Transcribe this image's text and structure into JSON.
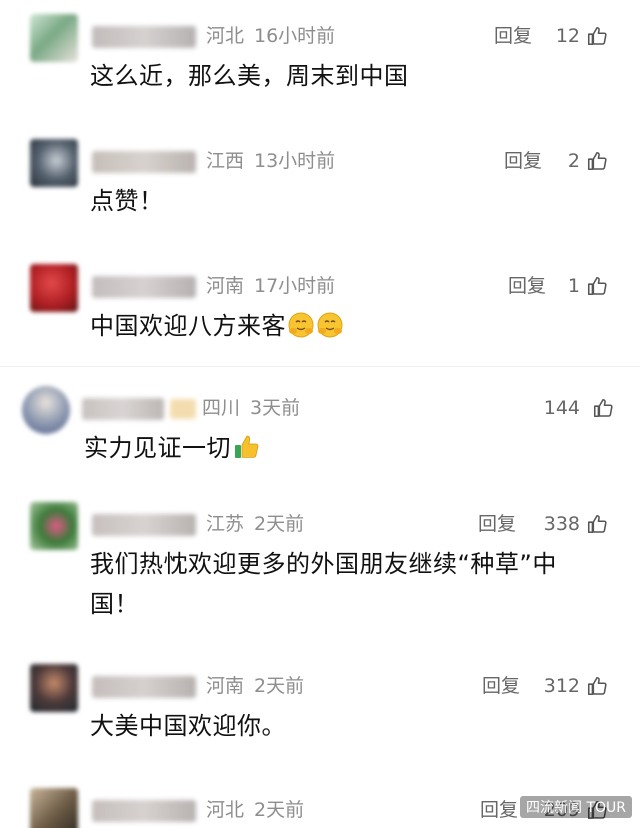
{
  "colors": {
    "meta": "#8e8e8e",
    "text": "#111111",
    "divider": "#eeeeee"
  },
  "comments": [
    {
      "location": "河北",
      "time": "16小时前",
      "reply": "回复",
      "likes": "12",
      "text": "这么近，那么美，周末到中国"
    },
    {
      "location": "江西",
      "time": "13小时前",
      "reply": "回复",
      "likes": "2",
      "text": "点赞！"
    },
    {
      "location": "河南",
      "time": "17小时前",
      "reply": "回复",
      "likes": "1",
      "text": "中国欢迎八方来客",
      "emoji": [
        "hug-face-icon",
        "hug-face-icon"
      ]
    },
    {
      "location": "四川",
      "time": "3天前",
      "likes": "144",
      "text": "实力见证一切",
      "emoji": [
        "thumbs-up-icon"
      ]
    },
    {
      "location": "江苏",
      "time": "2天前",
      "reply": "回复",
      "likes": "338",
      "text_line1": "我们热忱欢迎更多的外国朋友继续“种草”中",
      "text_line2": "国！"
    },
    {
      "location": "河南",
      "time": "2天前",
      "reply": "回复",
      "likes": "312",
      "text": "大美中国欢迎你。"
    },
    {
      "location": "河北",
      "time": "2天前",
      "reply": "回复",
      "likes": "209"
    }
  ],
  "watermark": "四流新闻 TOUR"
}
